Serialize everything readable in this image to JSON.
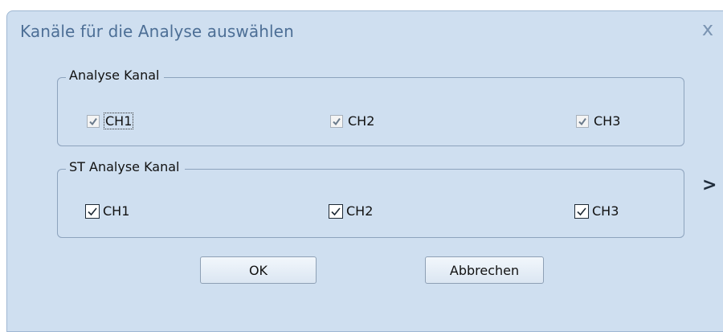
{
  "dialog": {
    "title": "Kanäle für die Analyse auswählen",
    "close_glyph": "x"
  },
  "analyse_group": {
    "legend": "Analyse Kanal",
    "channels": [
      {
        "label": "CH1",
        "checked": true,
        "enabled": false,
        "focused": true
      },
      {
        "label": "CH2",
        "checked": true,
        "enabled": false
      },
      {
        "label": "CH3",
        "checked": true,
        "enabled": false
      }
    ]
  },
  "st_group": {
    "legend": "ST Analyse Kanal",
    "channels": [
      {
        "label": "CH1",
        "checked": true,
        "enabled": true
      },
      {
        "label": "CH2",
        "checked": true,
        "enabled": true
      },
      {
        "label": "CH3",
        "checked": true,
        "enabled": true
      }
    ]
  },
  "buttons": {
    "ok": "OK",
    "cancel": "Abbrechen"
  },
  "side_arrow_glyph": ">",
  "colors": {
    "dialog_bg": "#cfdff0",
    "title_text": "#4d6f96",
    "border": "#8da3bd"
  }
}
